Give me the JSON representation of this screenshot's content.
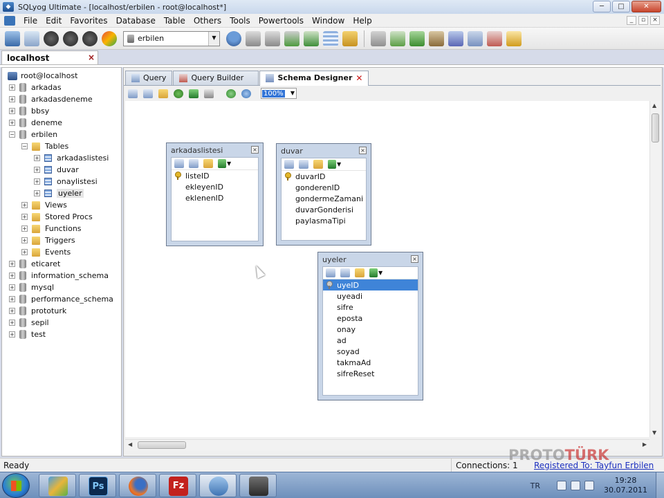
{
  "window": {
    "title": "SQLyog Ultimate - [localhost/erbilen - root@localhost*]",
    "minimize": "─",
    "maximize": "□",
    "close": "✕"
  },
  "menu": {
    "items": [
      "File",
      "Edit",
      "Favorites",
      "Database",
      "Table",
      "Others",
      "Tools",
      "Powertools",
      "Window",
      "Help"
    ]
  },
  "toolbar": {
    "database_select": "erbilen"
  },
  "connection_tab": {
    "label": "localhost",
    "close": "×"
  },
  "object_browser": {
    "root": "root@localhost",
    "databases": [
      "arkadas",
      "arkadasdeneme",
      "bbsy",
      "deneme",
      "erbilen",
      "eticaret",
      "information_schema",
      "mysql",
      "performance_schema",
      "prototurk",
      "sepil",
      "test"
    ],
    "expanded_db": "erbilen",
    "folders": [
      "Tables",
      "Views",
      "Stored Procs",
      "Functions",
      "Triggers",
      "Events"
    ],
    "tables": [
      "arkadaslistesi",
      "duvar",
      "onaylistesi",
      "uyeler"
    ],
    "selected_table": "uyeler"
  },
  "tabs": [
    {
      "label": "Query",
      "active": false
    },
    {
      "label": "Query Builder",
      "active": false
    },
    {
      "label": "Schema Designer",
      "active": true
    }
  ],
  "schema_toolbar": {
    "zoom": "100%"
  },
  "schema_tables": [
    {
      "name": "arkadaslistesi",
      "primary_key": "listeID",
      "columns": [
        "listeID",
        "ekleyenID",
        "eklenenID"
      ]
    },
    {
      "name": "duvar",
      "primary_key": "duvarID",
      "columns": [
        "duvarID",
        "gonderenID",
        "gondermeZamani",
        "duvarGonderisi",
        "paylasmaTipi"
      ]
    },
    {
      "name": "uyeler",
      "primary_key": "uyeID",
      "selected_column": "uyeID",
      "columns": [
        "uyeID",
        "uyeadi",
        "sifre",
        "eposta",
        "onay",
        "ad",
        "soyad",
        "takmaAd",
        "sifreReset"
      ]
    }
  ],
  "statusbar": {
    "ready": "Ready",
    "connections": "Connections: 1",
    "registered": "Registered To: Tayfun Erbilen"
  },
  "watermark": {
    "part1": "PROTO",
    "part2": "TÜRK"
  },
  "taskbar": {
    "language": "TR",
    "time": "19:28",
    "date": "30.07.2011",
    "apps": [
      {
        "icon": "control-panel-icon",
        "glyph": ""
      },
      {
        "icon": "photoshop-icon",
        "glyph": "Ps"
      },
      {
        "icon": "firefox-icon",
        "glyph": ""
      },
      {
        "icon": "filezilla-icon",
        "glyph": "Fz"
      },
      {
        "icon": "sqlyog-icon",
        "glyph": ""
      },
      {
        "icon": "camtasia-icon",
        "glyph": ""
      }
    ]
  },
  "colors": {
    "selection": "#3f84d8",
    "table_frame": "#c9d6e8",
    "taskbar": "#7d9cc5"
  }
}
